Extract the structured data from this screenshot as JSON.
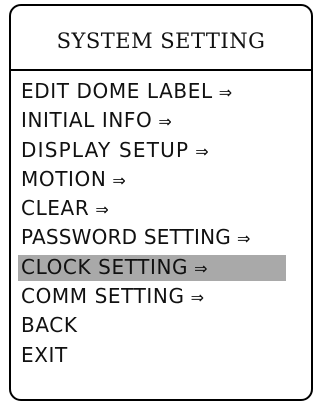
{
  "menu": {
    "title": "SYSTEM SETTING",
    "arrow": "⇒",
    "items": [
      {
        "label": "EDIT DOME LABEL",
        "arrow": "⇒"
      },
      {
        "label": "INITIAL INFO",
        "arrow": "⇒"
      },
      {
        "label": "DISPLAY SETUP",
        "arrow": "⇒"
      },
      {
        "label": "MOTION",
        "arrow": "⇒"
      },
      {
        "label": "CLEAR",
        "arrow": "⇒"
      },
      {
        "label": "PASSWORD SETTING",
        "arrow": "⇒"
      },
      {
        "label": "CLOCK SETTING",
        "arrow": "⇒",
        "selected": true
      },
      {
        "label": "COMM SETTING",
        "arrow": "⇒"
      },
      {
        "label": "BACK"
      },
      {
        "label": "EXIT"
      }
    ],
    "selected_index": 6,
    "highlight_color": "#a9a9a9",
    "border_color": "#000000"
  }
}
